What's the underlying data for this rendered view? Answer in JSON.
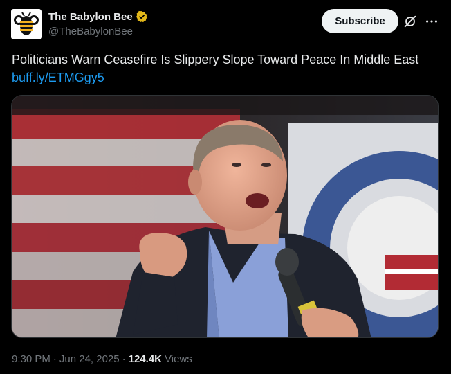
{
  "author": {
    "display_name": "The Babylon Bee",
    "handle": "@TheBabylonBee",
    "verified_icon": "verified-badge-icon",
    "verified_color": "#e2b719",
    "avatar_icon": "bee-logo-icon"
  },
  "actions": {
    "subscribe_label": "Subscribe",
    "grok_icon": "grok-icon",
    "more_icon": "more-options-icon"
  },
  "tweet": {
    "text": "Politicians Warn Ceasefire Is Slippery Slope Toward Peace In Middle East",
    "link": "buff.ly/ETMGgy5",
    "link_color": "#1d9bf0"
  },
  "media": {
    "type": "photo"
  },
  "meta": {
    "time": "9:30 PM",
    "separator1": "·",
    "date": "Jun 24, 2025",
    "separator2": "·",
    "views_count": "124.4K",
    "views_label": "Views"
  }
}
